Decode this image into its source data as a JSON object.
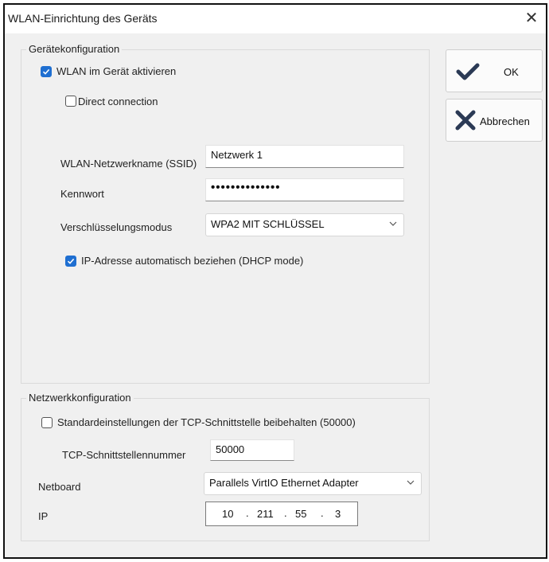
{
  "window": {
    "title": "WLAN-Einrichtung des Geräts",
    "close_glyph": "✕"
  },
  "device_config": {
    "group_title": "Gerätekonfiguration",
    "enable_wlan": {
      "label": "WLAN im Gerät aktivieren",
      "checked": true
    },
    "direct_connection": {
      "label": "Direct connection",
      "checked": false
    },
    "ssid": {
      "label": "WLAN-Netzwerkname (SSID)",
      "value": "Netzwerk 1"
    },
    "password": {
      "label": "Kennwort",
      "value": "••••••••••••••"
    },
    "encryption": {
      "label": "Verschlüsselungsmodus",
      "value": "WPA2 MIT SCHLÜSSEL"
    },
    "dhcp": {
      "label": "IP-Adresse automatisch beziehen (DHCP mode)",
      "checked": true
    }
  },
  "network_config": {
    "group_title": "Netzwerkkonfiguration",
    "keep_defaults": {
      "label": "Standardeinstellungen der TCP-Schnittstelle beibehalten (50000)",
      "checked": false
    },
    "tcp_port": {
      "label": "TCP-Schnittstellennummer",
      "value": "50000"
    },
    "netboard": {
      "label": "Netboard",
      "value": "Parallels VirtIO Ethernet Adapter"
    },
    "ip": {
      "label": "IP",
      "octets": [
        "10",
        "211",
        "55",
        "3"
      ]
    }
  },
  "buttons": {
    "ok": {
      "label": "OK"
    },
    "cancel": {
      "label": "Abbrechen"
    }
  },
  "colors": {
    "accent": "#1f6fd1",
    "ok_icon": "#2b3a55",
    "cancel_icon": "#2b3a55"
  }
}
